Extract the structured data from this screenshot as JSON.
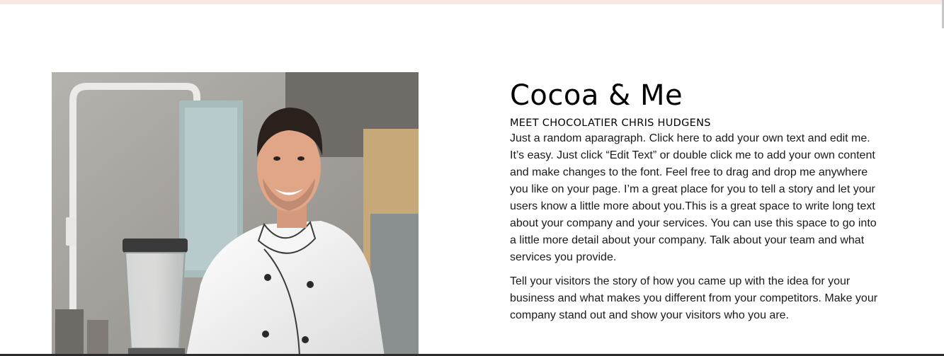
{
  "section": {
    "title": "Cocoa & Me",
    "subtitle": "MEET CHOCOLATIER CHRIS HUDGENS",
    "paragraphs": [
      "Just a random aparagraph. Click here to add your own text and edit me. It’s easy. Just click “Edit Text” or double click me to add your own content and make changes to the font. Feel free to drag and drop me anywhere you like on your page. I’m a great place for you to tell a story and let your users know a little more about you.This is a great space to write long text about your company and your services. You can use this space to go into a little more detail about your company. Talk about your team and what services you provide.",
      "Tell your visitors the story of how you came up with the idea for your business and what makes you different from your competitors. Make your company stand out and show your visitors who you are."
    ]
  },
  "colors": {
    "top_strip": "#fbe6e6",
    "text": "#1a1a1a"
  },
  "image": {
    "subject": "smiling chef in white jacket in kitchen"
  }
}
